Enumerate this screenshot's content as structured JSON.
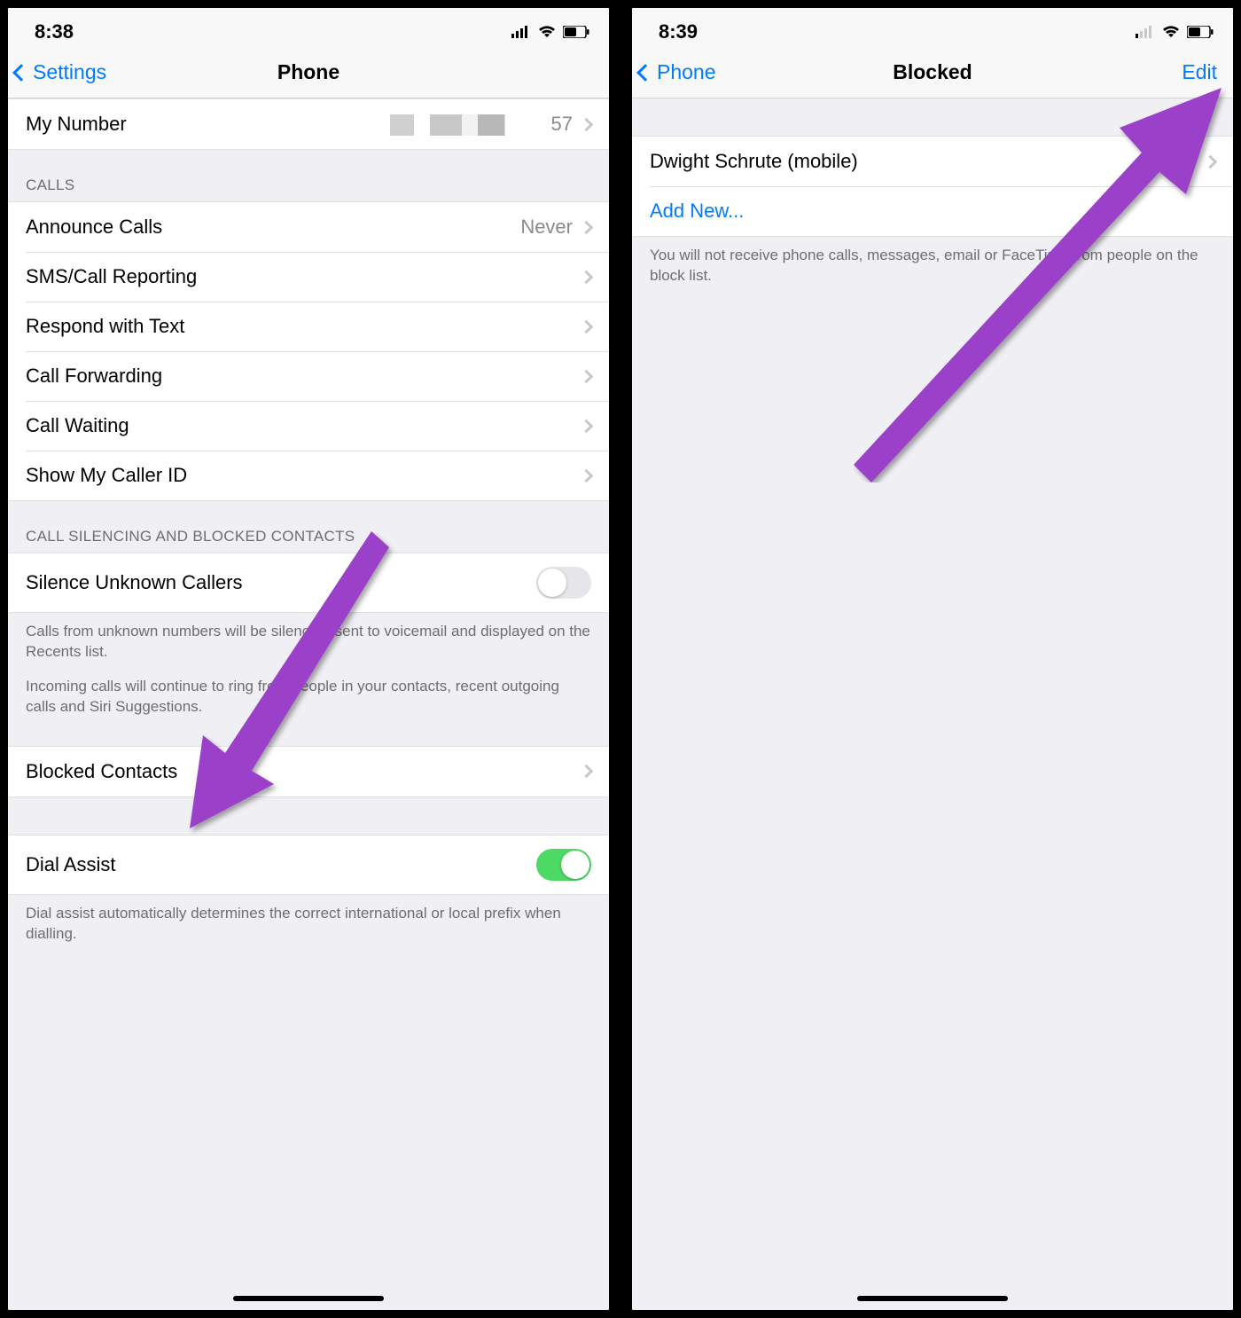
{
  "left": {
    "status": {
      "time": "8:38"
    },
    "nav": {
      "back": "Settings",
      "title": "Phone"
    },
    "my_number": {
      "label": "My Number",
      "value_suffix": "57"
    },
    "sections": {
      "calls": {
        "header": "CALLS",
        "items": [
          {
            "label": "Announce Calls",
            "value": "Never"
          },
          {
            "label": "SMS/Call Reporting"
          },
          {
            "label": "Respond with Text"
          },
          {
            "label": "Call Forwarding"
          },
          {
            "label": "Call Waiting"
          },
          {
            "label": "Show My Caller ID"
          }
        ]
      },
      "silencing": {
        "header": "CALL SILENCING AND BLOCKED CONTACTS",
        "silence_unknown": {
          "label": "Silence Unknown Callers",
          "on": false
        },
        "footer1": "Calls from unknown numbers will be silenced, sent to voicemail and displayed on the Recents list.",
        "footer2": "Incoming calls will continue to ring from people in your contacts, recent outgoing calls and Siri Suggestions.",
        "blocked_contacts": {
          "label": "Blocked Contacts"
        }
      },
      "dial": {
        "dial_assist": {
          "label": "Dial Assist",
          "on": true
        },
        "footer": "Dial assist automatically determines the correct international or local prefix when dialling."
      }
    }
  },
  "right": {
    "status": {
      "time": "8:39"
    },
    "nav": {
      "back": "Phone",
      "title": "Blocked",
      "edit": "Edit"
    },
    "blocked_item": "Dwight Schrute (mobile)",
    "add_new": "Add New...",
    "footer": "You will not receive phone calls, messages, email or FaceTime from people on the block list."
  }
}
